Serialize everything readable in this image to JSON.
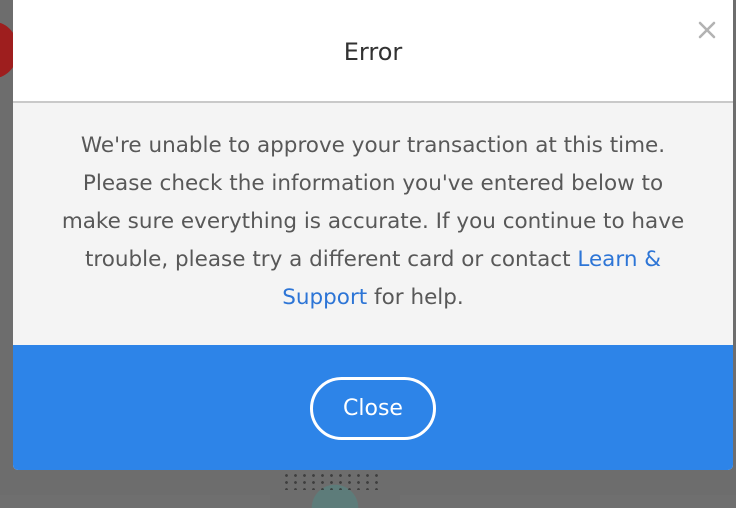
{
  "dialog": {
    "title": "Error",
    "close_icon": "close-icon",
    "message": {
      "text_before_link": "We're unable to approve your transaction at this time. Please check the information you've entered below to make sure everything is accurate. If you continue to have trouble, please try a different card or contact ",
      "link_text": "Learn & Support",
      "text_after_link": " for help."
    },
    "close_button_label": "Close"
  },
  "colors": {
    "accent_blue": "#2d84e8",
    "link_blue": "#2d75d6",
    "body_text": "#585858",
    "title_text": "#323232"
  }
}
